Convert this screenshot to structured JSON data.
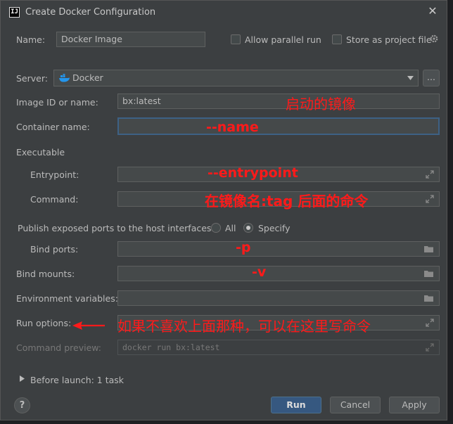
{
  "window": {
    "title": "Create Docker Configuration",
    "logo_text": "IJ"
  },
  "top": {
    "name_label": "Name:",
    "name_value": "Docker Image",
    "parallel_label": "Allow parallel run",
    "store_label": "Store as project file"
  },
  "server": {
    "label": "Server:",
    "value": "Docker",
    "more_label": "..."
  },
  "image": {
    "label": "Image ID or name:",
    "value": "bx:latest"
  },
  "container": {
    "label": "Container name:",
    "value": ""
  },
  "executable": {
    "section_label": "Executable",
    "entrypoint_label": "Entrypoint:",
    "command_label": "Command:"
  },
  "ports": {
    "publish_label": "Publish exposed ports to the host interfaces:",
    "option_all": "All",
    "option_specify": "Specify",
    "selected": "Specify",
    "bind_ports_label": "Bind ports:"
  },
  "mounts": {
    "label": "Bind mounts:"
  },
  "env": {
    "label": "Environment variables:"
  },
  "run_options": {
    "label": "Run options:"
  },
  "preview": {
    "label": "Command preview:",
    "value": "docker run bx:latest"
  },
  "before_launch": {
    "label": "Before launch: 1 task"
  },
  "buttons": {
    "help": "?",
    "run": "Run",
    "cancel": "Cancel",
    "apply": "Apply"
  },
  "annotations": {
    "image": "启动的镜像",
    "name": "--name",
    "entrypoint": "--entrypoint",
    "command": "在镜像名:tag 后面的命令",
    "ports": "-p",
    "mounts": "-v",
    "run_options": "如果不喜欢上面那种，可以在这里写命令"
  },
  "colors": {
    "annotation": "#ff1a1a",
    "dialog_bg": "#3c3f41",
    "primary_button": "#365880",
    "docker_blue": "#2496ed"
  },
  "icons": [
    "docker-icon",
    "gear-icon",
    "expand-icon",
    "folder-icon",
    "chevron-down-icon",
    "chevron-right-icon",
    "close-icon",
    "red-arrow"
  ]
}
